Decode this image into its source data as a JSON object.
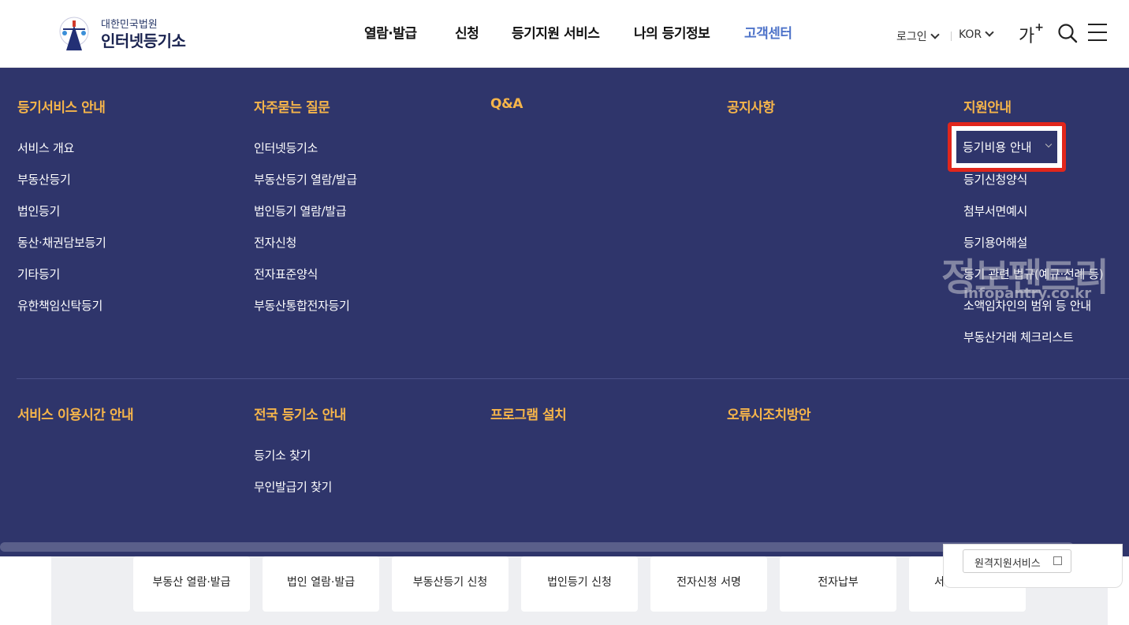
{
  "header": {
    "logo_sub": "대한민국법원",
    "logo_main": "인터넷등기소",
    "nav": [
      "열람·발급",
      "신청",
      "등기지원 서비스",
      "나의 등기정보",
      "고객센터"
    ],
    "nav_active_index": 4,
    "login_label": "로그인",
    "lang_label": "KOR",
    "font_size_label": "가",
    "font_size_plus": "+"
  },
  "mega_menu": {
    "row1": [
      {
        "title": "등기서비스 안내",
        "items": [
          "서비스 개요",
          "부동산등기",
          "법인등기",
          "동산·채권담보등기",
          "기타등기",
          "유한책임신탁등기"
        ]
      },
      {
        "title": "자주묻는 질문",
        "items": [
          "인터넷등기소",
          "부동산등기 열람/발급",
          "법인등기 열람/발급",
          "전자신청",
          "전자표준양식",
          "부동산통합전자등기"
        ]
      },
      {
        "title": "Q&A",
        "items": []
      },
      {
        "title": "공지사항",
        "items": []
      },
      {
        "title": "지원안내",
        "items": [
          "등기비용 안내",
          "등기신청양식",
          "첨부서면예시",
          "등기용어해설",
          "등기 관련 법규(예규·선례 등)",
          "소액임차인의 범위 등 안내",
          "부동산거래 체크리스트"
        ]
      }
    ],
    "row2": [
      {
        "title": "서비스 이용시간 안내",
        "items": []
      },
      {
        "title": "전국 등기소 안내",
        "items": [
          "등기소 찾기",
          "무인발급기 찾기"
        ]
      },
      {
        "title": "프로그램 설치",
        "items": []
      },
      {
        "title": "오류시조치방안",
        "items": []
      }
    ]
  },
  "watermark": {
    "main": "정보팬트리",
    "sub": "infopantry.co.kr"
  },
  "quick_links": [
    "부동산 열람·발급",
    "법인 열람·발급",
    "부동산등기 신청",
    "법인등기 신청",
    "전자신청 서명",
    "전자납부",
    "서"
  ],
  "popup": {
    "button_label": "원격지원서비스"
  },
  "colors": {
    "menu_bg": "#2f356b",
    "title_accent": "#f6b54a",
    "nav_active": "#4e73c9",
    "highlight": "#e1261c"
  }
}
